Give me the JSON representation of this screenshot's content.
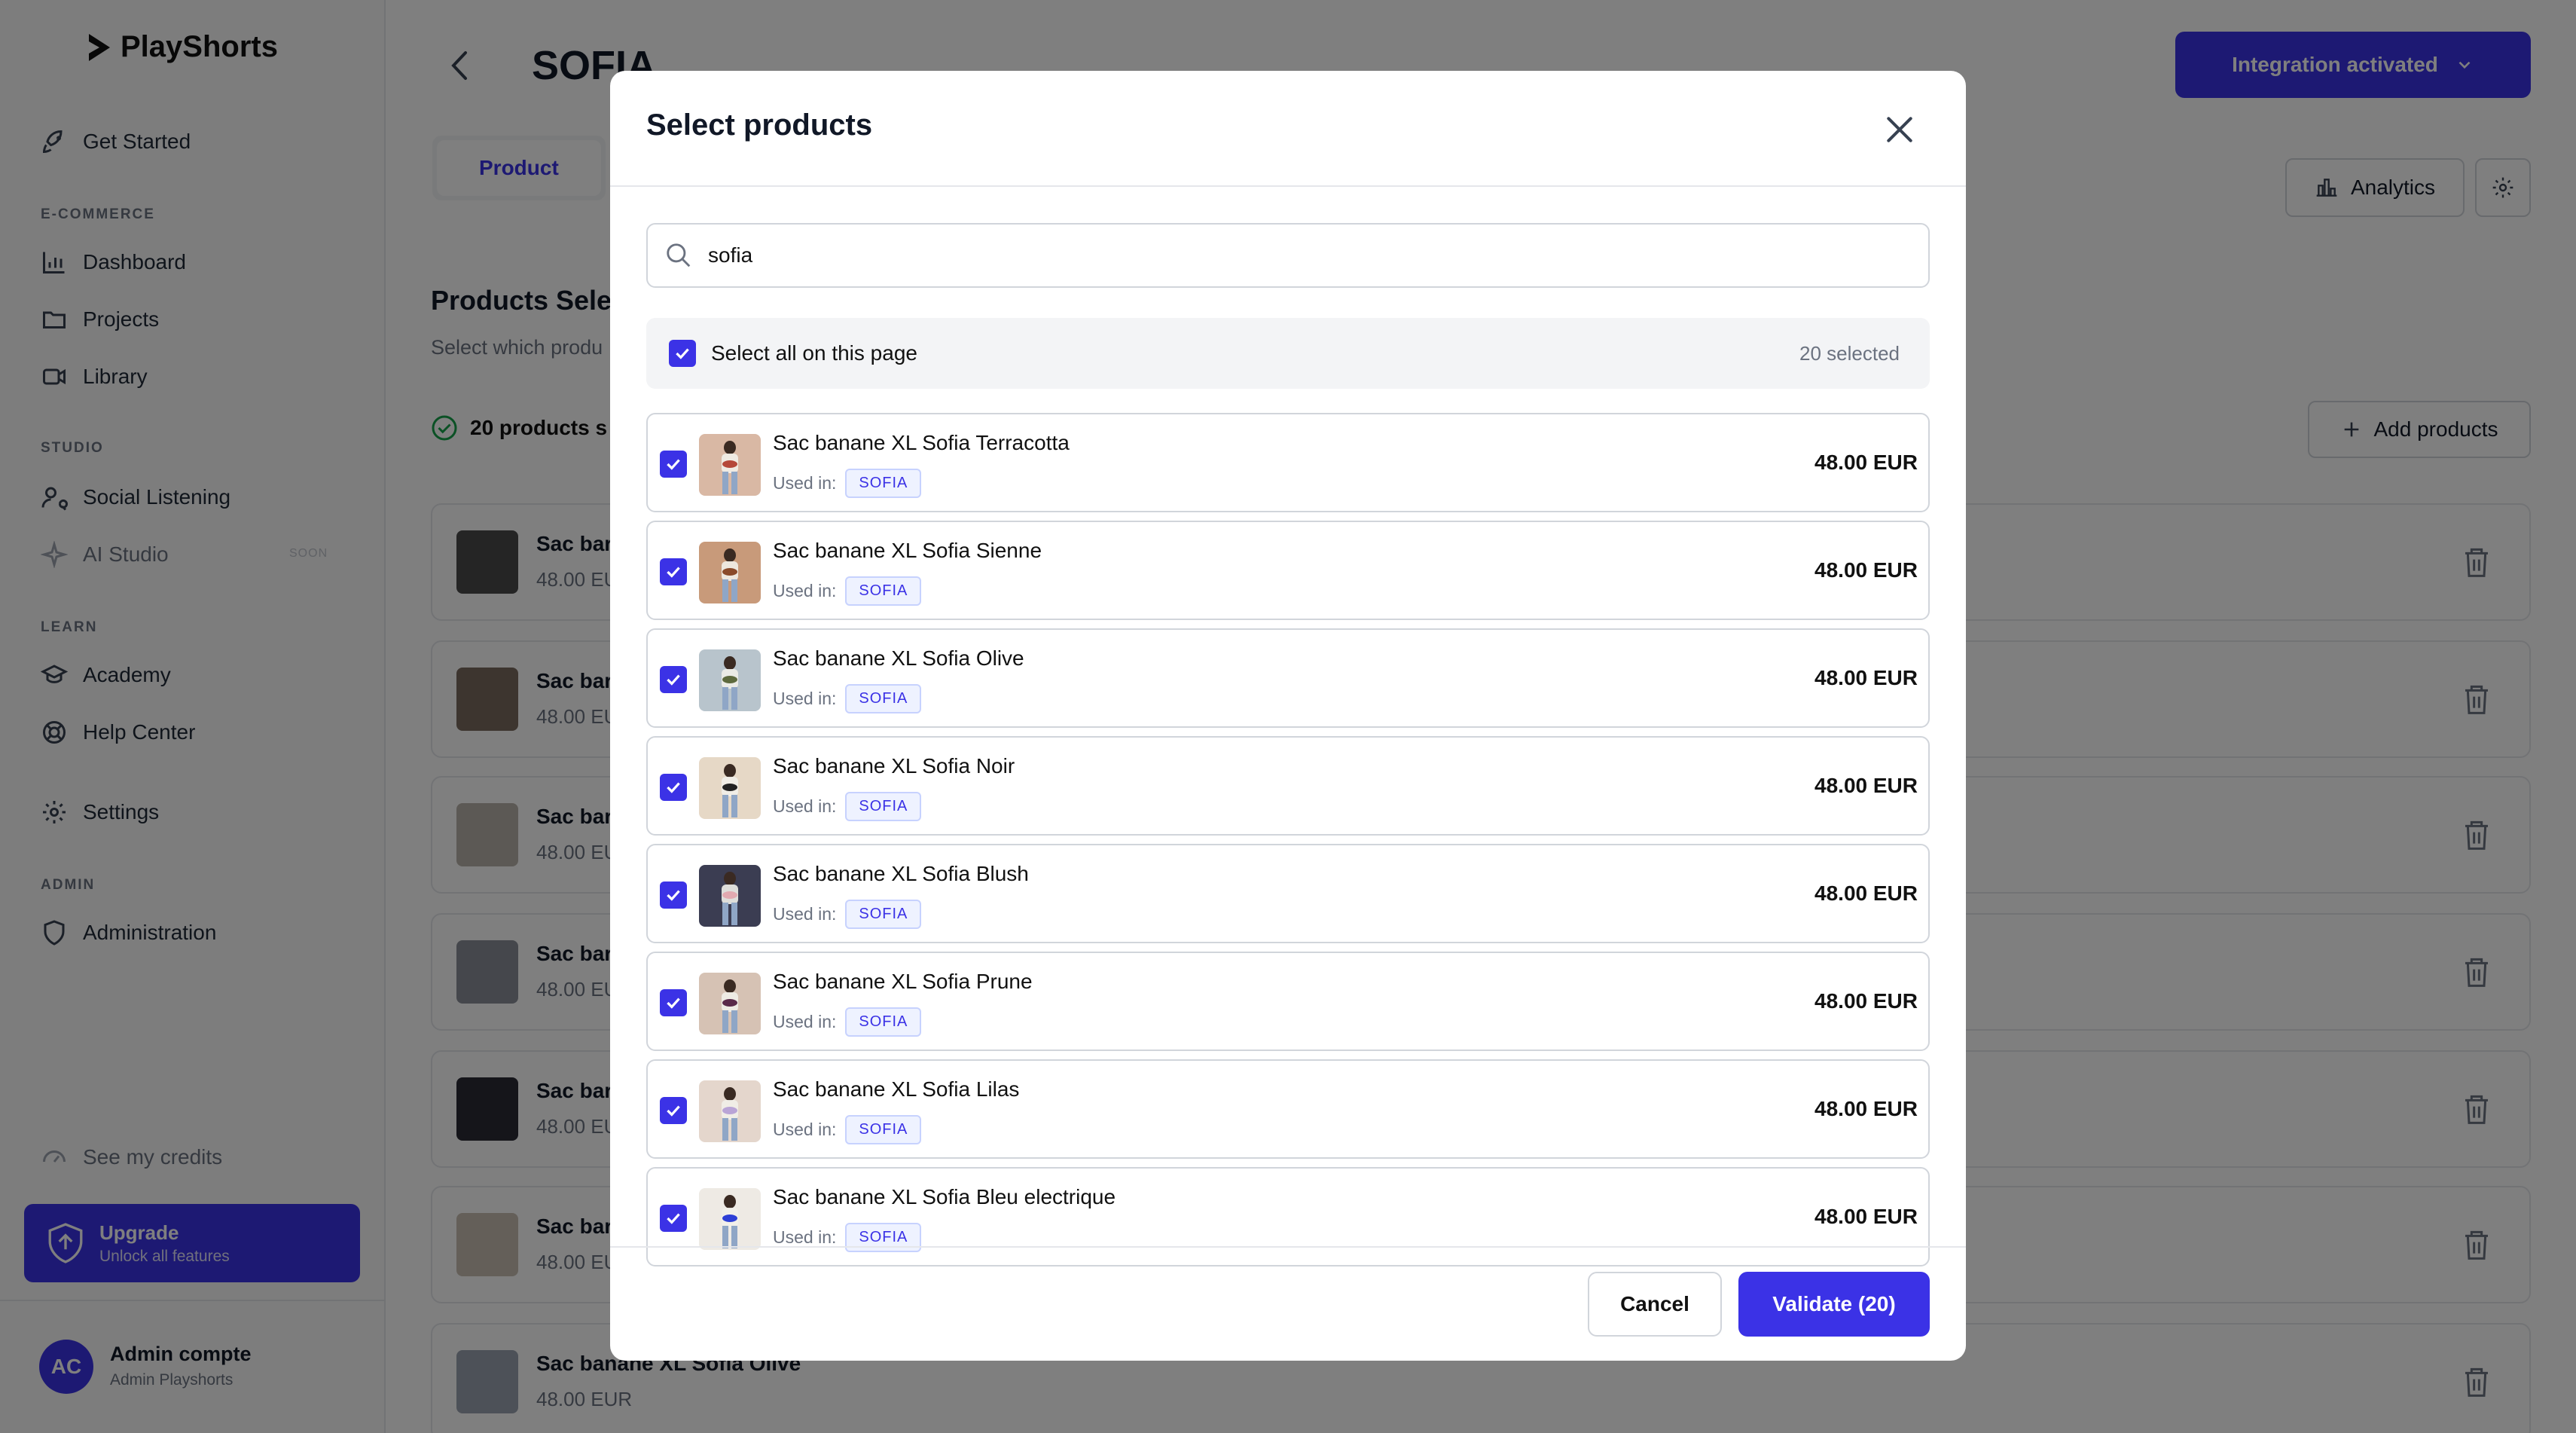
{
  "app": {
    "name": "PlayShorts"
  },
  "sidebar": {
    "get_started": "Get Started",
    "sections": {
      "ecommerce": "E-COMMERCE",
      "studio": "STUDIO",
      "learn": "LEARN",
      "admin": "ADMIN"
    },
    "items": {
      "dashboard": "Dashboard",
      "projects": "Projects",
      "library": "Library",
      "social_listening": "Social Listening",
      "ai_studio": "AI Studio",
      "ai_studio_badge": "SOON",
      "academy": "Academy",
      "help_center": "Help Center",
      "settings": "Settings",
      "administration": "Administration"
    },
    "credits": "See my credits",
    "upgrade": {
      "title": "Upgrade",
      "subtitle": "Unlock all features"
    },
    "user": {
      "initials": "AC",
      "name": "Admin compte",
      "role": "Admin Playshorts"
    }
  },
  "header": {
    "title": "SOFIA",
    "integration_button": "Integration activated",
    "tab_product": "Product",
    "analytics_button": "Analytics"
  },
  "main": {
    "section_title": "Products Selec",
    "section_subtitle": "Select which produ",
    "count_label": "20 products s",
    "add_products": "Add products",
    "rows": [
      {
        "name": "Sac bar",
        "price": "48.00 EU",
        "thumb": "#4b4b4b"
      },
      {
        "name": "Sac bar",
        "price": "48.00 EU",
        "thumb": "#7a6a5e"
      },
      {
        "name": "Sac bar",
        "price": "48.00 EU",
        "thumb": "#b9b3aa"
      },
      {
        "name": "Sac bar",
        "price": "48.00 EU",
        "thumb": "#8a8f99"
      },
      {
        "name": "Sac bar",
        "price": "48.00 EU",
        "thumb": "#2a2a35"
      },
      {
        "name": "Sac bar",
        "price": "48.00 EU",
        "thumb": "#c9bfb2"
      },
      {
        "name": "Sac banane XL Sofia Olive",
        "price": "48.00 EUR",
        "thumb": "#9aa3b0"
      }
    ]
  },
  "modal": {
    "title": "Select products",
    "search": {
      "value": "sofia"
    },
    "select_all_label": "Select all on this page",
    "selected_count": "20 selected",
    "used_in_label": "Used in:",
    "products": [
      {
        "name": "Sac banane XL Sofia Terracotta",
        "tag": "SOFIA",
        "price": "48.00 EUR",
        "checked": true,
        "thumb": "#d9b8a4",
        "bag": "#b5483a"
      },
      {
        "name": "Sac banane XL Sofia Sienne",
        "tag": "SOFIA",
        "price": "48.00 EUR",
        "checked": true,
        "thumb": "#c89a7a",
        "bag": "#8a4a2a"
      },
      {
        "name": "Sac banane XL Sofia Olive",
        "tag": "SOFIA",
        "price": "48.00 EUR",
        "checked": true,
        "thumb": "#b8c4cc",
        "bag": "#5e6a3e"
      },
      {
        "name": "Sac banane XL Sofia Noir",
        "tag": "SOFIA",
        "price": "48.00 EUR",
        "checked": true,
        "thumb": "#e6d8c6",
        "bag": "#222222"
      },
      {
        "name": "Sac banane XL Sofia Blush",
        "tag": "SOFIA",
        "price": "48.00 EUR",
        "checked": true,
        "thumb": "#3b3d52",
        "bag": "#e2a9b0"
      },
      {
        "name": "Sac banane XL Sofia Prune",
        "tag": "SOFIA",
        "price": "48.00 EUR",
        "checked": true,
        "thumb": "#d6c2b4",
        "bag": "#5a2a4a"
      },
      {
        "name": "Sac banane XL Sofia Lilas",
        "tag": "SOFIA",
        "price": "48.00 EUR",
        "checked": true,
        "thumb": "#e4d6cc",
        "bag": "#b9a4d6"
      },
      {
        "name": "Sac banane XL Sofia Bleu electrique",
        "tag": "SOFIA",
        "price": "48.00 EUR",
        "checked": true,
        "thumb": "#eeeae4",
        "bag": "#2d3fd6"
      }
    ],
    "cancel": "Cancel",
    "validate": "Validate (20)"
  },
  "colors": {
    "accent": "#3b32e6",
    "overlay": "rgba(0,0,0,0.5)"
  }
}
